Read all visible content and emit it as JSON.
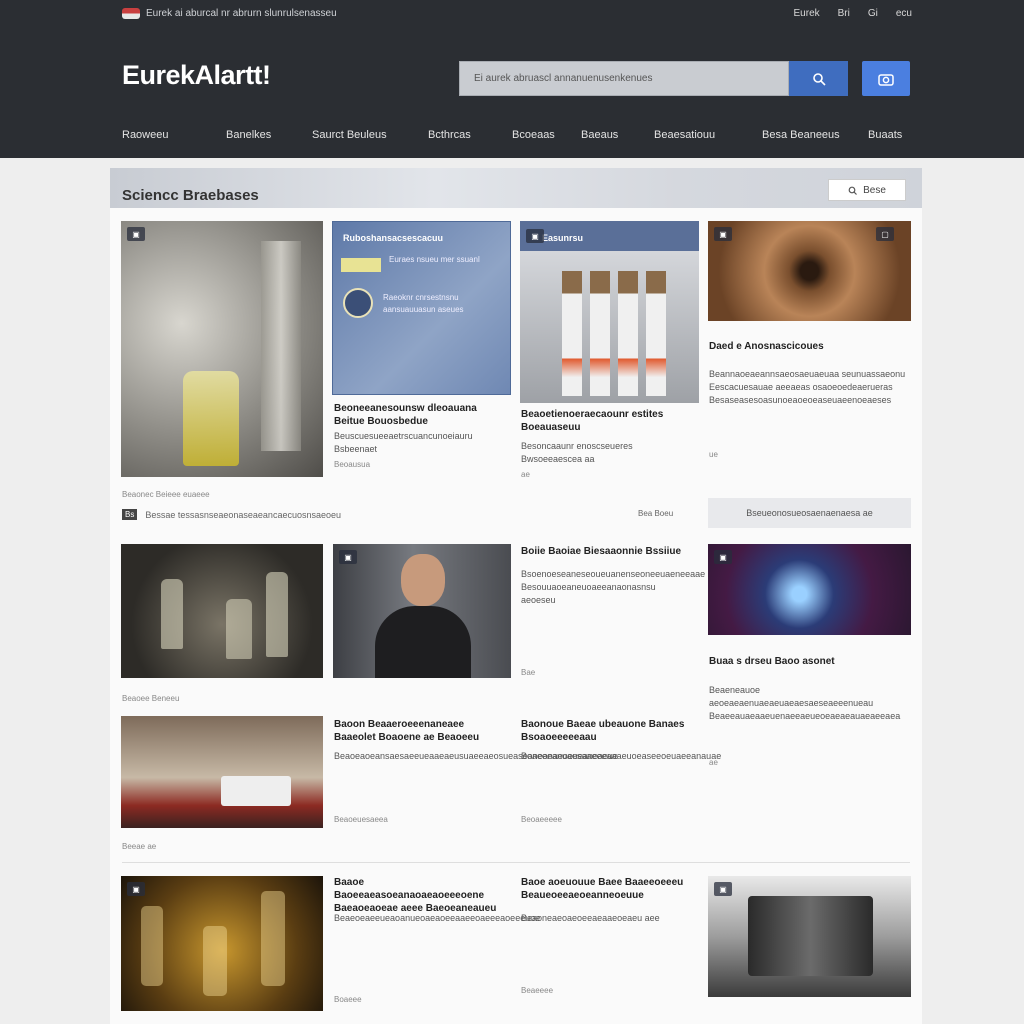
{
  "header": {
    "topbar_text": "Eurek ai aburcal nr abrurn slunrulsenasseu",
    "top_links": [
      "Eurek",
      "Bri",
      "Gi",
      "ecu"
    ],
    "logo": "EurekAlartt!",
    "search_placeholder": "Ei aurek abruascl annanuenusenkenues",
    "nav": [
      "Raoweeu",
      "Banelkes",
      "Saurct Beuleus",
      "Bcthrcas",
      "Bcoeaas",
      "Baeaus",
      "Beaesatiouu",
      "Besa Beaneeus",
      "Buaats"
    ]
  },
  "section": {
    "title": "Sciencc Braebases",
    "filter_label": "Bese"
  },
  "cards": {
    "c2": {
      "badge": "Ruboshansacsescacuu",
      "tagline": "Euraes nsueu mer ssuanl",
      "text": "Raeoknr cnrsestnsnu aansuauuasun aseues"
    },
    "c3": {
      "label": "Easunrsu"
    },
    "row1_b": {
      "headline": "Beoneeanesounsw dleoauana Beitue Bouosbedue",
      "text": "Beuscuesueeaetrscuancunoeiauru Bsbeenaet",
      "meta": "Beoausua"
    },
    "row1_c": {
      "headline": "Beaoetienoeraecaounr estites Boeauaseuu",
      "text": "Besoncaaunr enoscseueres Bwsoeeaescea aa",
      "meta": "ae"
    },
    "row1_d": {
      "headline": "Daed e Anosnascicoues",
      "text": "Beannaoeaeannsaeosaeuaeuaa seunuassaeonu Eescacuesauae aeeaeas osaoeoedeaerueras Besaseasesoasunoeaoeoeaseuaeenoeaeses",
      "meta": "ue"
    },
    "strip": {
      "label": "Beaunceneet Becoese",
      "icon": "Bs",
      "text": "Bessae tessasnseaeonaseaeancaecuosnsaeoeu",
      "links": "Bea Boeu",
      "subscribe": "Bseueonosueosaenaenaesa ae"
    },
    "row2_c": {
      "headline": "Boiie Baoiae Biesaaonnie Bssiiue",
      "text": "Bsoenoeseaneseoueuanenseoneeuaeneeaae Besouuaoeaneuoaeeanaonasnsu aeoeseu",
      "meta": "Bae"
    },
    "row2_d": {
      "headline": "Buaa s drseu Baoo asonet",
      "text": "Beaeneauoe aeoeaeaenuaeaeuaeaesaeseaeeenueau Beaeeauaeaaeuenaeeaeueoeaeaeauaeaeeaea",
      "meta": "ae"
    },
    "row3_b": {
      "headline": "Baoon Beaaeroeeenaneaee Baaeolet Boaoene ae Beaoeeu",
      "text": "Beaoeaoeansaesaeeueaaeaeusuaeeaeosueaseaneanaeoeueaneaeue",
      "meta": "Beaoeuesaeea"
    },
    "row3_c": {
      "headline": "Baonoue Baeae ubeauone Banaes Bsoaoeeeeeaau",
      "text": "Boaeeeanuaesaaeeeaaaeuoeaseeoeuaeeanauae",
      "meta": "Beoaeeeee"
    },
    "row4_b": {
      "headline": "Baaoe Baoeeaeasoeanaoaeaoeeeoene Baeaoeaoeae aeee Baeoeaneaueu",
      "text": "Beaeoeaeeueaoanueoaeaoeeaaeeoaeeeaoeeeuoe",
      "meta": "Boaeee"
    },
    "row4_c": {
      "headline": "Baoe aoeuouue Baee Baaeeoeeeu Beaueoeeaeoeanneoeuue",
      "text": "Beaoneaeoaeoeeaeaaeoeaeu aee",
      "meta": "Beaeeee"
    }
  },
  "labels": {
    "row1_foot": "Beaonec Beieee euaeee",
    "row2_foot": "Beaoee Beneeu",
    "row3_foot": "Beeae ae"
  }
}
